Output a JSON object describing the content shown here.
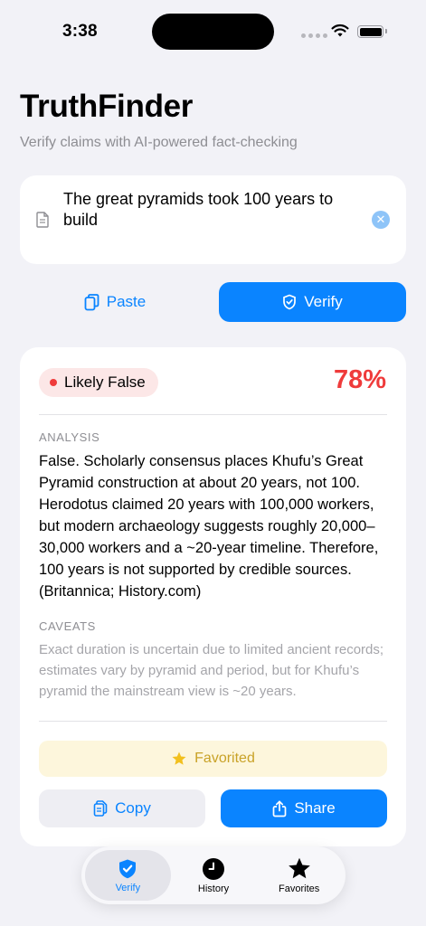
{
  "status_bar": {
    "time": "3:38"
  },
  "header": {
    "title": "TruthFinder",
    "subtitle": "Verify claims with AI-powered fact-checking"
  },
  "claim_input": {
    "value": "The great pyramids took 100 years to build"
  },
  "actions": {
    "paste_label": "Paste",
    "verify_label": "Verify"
  },
  "result": {
    "verdict": "Likely False",
    "confidence": "78%",
    "analysis_label": "ANALYSIS",
    "analysis": "False. Scholarly consensus places Khufu’s Great Pyramid construction at about 20 years, not 100. Herodotus claimed 20 years with 100,000 workers, but modern archaeology suggests roughly 20,000–30,000 workers and a ~20-year timeline. Therefore, 100 years is not supported by credible sources. (Britannica; History.com)",
    "caveats_label": "CAVEATS",
    "caveats": "Exact duration is uncertain due to limited ancient records; estimates vary by pyramid and period, but for Khufu’s pyramid the mainstream view is ~20 years.",
    "favorited_label": "Favorited",
    "copy_label": "Copy",
    "share_label": "Share"
  },
  "tab_bar": {
    "tabs": [
      {
        "label": "Verify",
        "icon": "shield-check-icon",
        "active": true
      },
      {
        "label": "History",
        "icon": "clock-icon",
        "active": false
      },
      {
        "label": "Favorites",
        "icon": "star-icon",
        "active": false
      }
    ]
  },
  "colors": {
    "accent": "#0A84FF",
    "false_red": "#EF3B3B",
    "favorite_gold": "#F2C01E",
    "background": "#F2F2F7"
  }
}
